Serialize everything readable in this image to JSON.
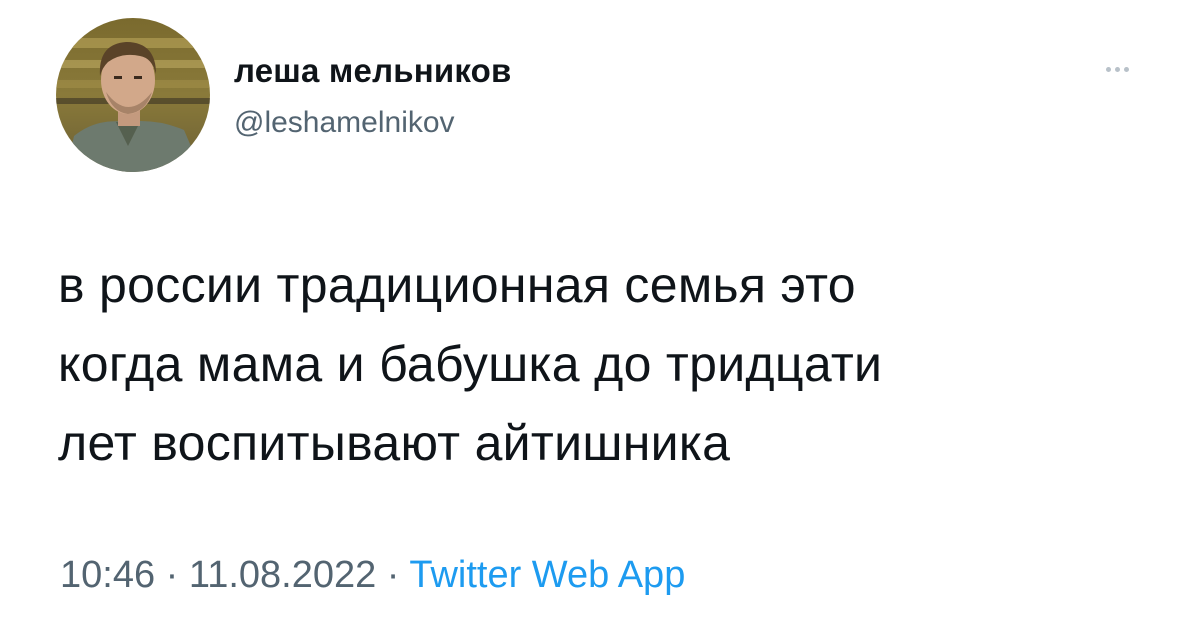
{
  "author": {
    "display_name": "леша мельников",
    "handle": "@leshamelnikov"
  },
  "tweet": {
    "lines": [
      "в россии традиционная семья это",
      "когда мама и бабушка до тридцати",
      "лет воспитывают айтишника"
    ]
  },
  "meta": {
    "time": "10:46",
    "separator": " · ",
    "date": "11.08.2022",
    "source": "Twitter Web App"
  },
  "icons": {
    "more": "more-horizontal-icon"
  },
  "colors": {
    "text": "#0f1419",
    "secondary": "#536471",
    "link": "#1d9bf0",
    "background": "#ffffff"
  }
}
